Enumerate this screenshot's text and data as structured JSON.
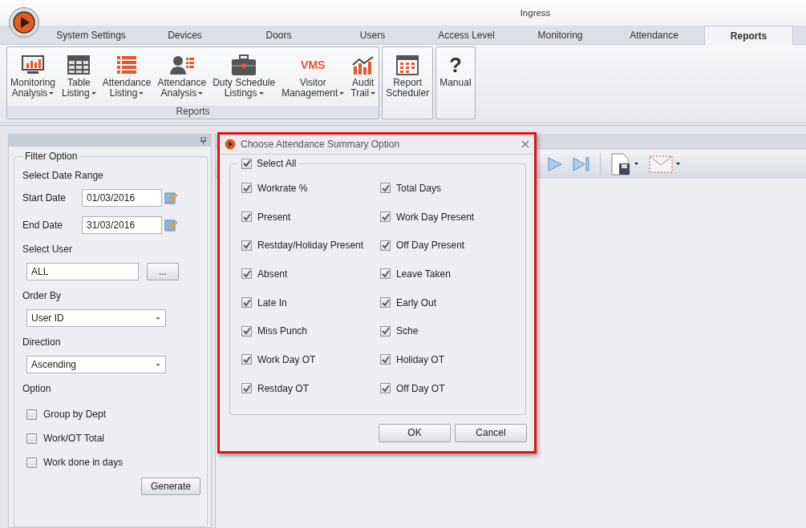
{
  "window": {
    "title": "Ingress"
  },
  "tabs": [
    {
      "label": "System Settings",
      "selected": false
    },
    {
      "label": "Devices",
      "selected": false
    },
    {
      "label": "Doors",
      "selected": false
    },
    {
      "label": "Users",
      "selected": false
    },
    {
      "label": "Access Level",
      "selected": false
    },
    {
      "label": "Monitoring",
      "selected": false
    },
    {
      "label": "Attendance",
      "selected": false
    },
    {
      "label": "Reports",
      "selected": true
    }
  ],
  "ribbon": [
    {
      "label": "Reports",
      "buttons": [
        {
          "label": "Monitoring\nAnalysis",
          "kind": "monitor",
          "dropdown": true
        },
        {
          "label": "Table\nListing",
          "kind": "table",
          "dropdown": true
        },
        {
          "label": "Attendance\nListing",
          "kind": "list",
          "dropdown": true
        },
        {
          "label": "Attendance\nAnalysis",
          "kind": "person",
          "dropdown": true
        },
        {
          "label": "Duty Schedule\nListings",
          "kind": "briefcase",
          "dropdown": true
        },
        {
          "label": "Visitor\nManagement",
          "kind": "logo",
          "glyph": "VMS",
          "dropdown": true
        },
        {
          "label": "Audit\nTrail",
          "kind": "chart",
          "dropdown": true
        }
      ]
    },
    {
      "buttons": [
        {
          "label": "Report\nScheduler",
          "kind": "calendar",
          "dropdown": false
        }
      ]
    },
    {
      "buttons": [
        {
          "label": "Manual",
          "kind": "glyph",
          "glyph": "?",
          "dropdown": false
        }
      ]
    }
  ],
  "filter": {
    "title": "Filter Option",
    "date_range_label": "Select Date Range",
    "start_date": {
      "label": "Start Date",
      "value": "01/03/2016"
    },
    "end_date": {
      "label": "End Date",
      "value": "31/03/2016"
    },
    "select_user": {
      "label": "Select User",
      "value": "ALL",
      "browse_button": "..."
    },
    "order_by": {
      "label": "Order By",
      "value": "User ID"
    },
    "direction": {
      "label": "Direction",
      "value": "Ascending"
    },
    "option_label": "Option",
    "options": [
      {
        "label": "Group by Dept",
        "checked": false
      },
      {
        "label": "Work/OT Total",
        "checked": false
      },
      {
        "label": "Work done in days",
        "checked": false
      }
    ],
    "generate_button": "Generate"
  },
  "dialog": {
    "title": "Choose Attendance Summary Option",
    "select_all": {
      "label": "Select All",
      "checked": true
    },
    "options": [
      {
        "label": "Workrate %",
        "checked": true
      },
      {
        "label": "Total Days",
        "checked": true
      },
      {
        "label": "Present",
        "checked": true
      },
      {
        "label": "Work Day Present",
        "checked": true
      },
      {
        "label": "Restday/Holiday Present",
        "checked": true
      },
      {
        "label": "Off Day Present",
        "checked": true
      },
      {
        "label": "Absent",
        "checked": true
      },
      {
        "label": "Leave Taken",
        "checked": true
      },
      {
        "label": "Late In",
        "checked": true
      },
      {
        "label": "Early Out",
        "checked": true
      },
      {
        "label": "Miss Punch",
        "checked": true
      },
      {
        "label": "Sche",
        "checked": true
      },
      {
        "label": "Work Day OT",
        "checked": true
      },
      {
        "label": "Holiday OT",
        "checked": true
      },
      {
        "label": "Restday OT",
        "checked": true
      },
      {
        "label": "Off Day OT",
        "checked": true
      }
    ],
    "buttons": [
      "OK",
      "Cancel"
    ]
  }
}
